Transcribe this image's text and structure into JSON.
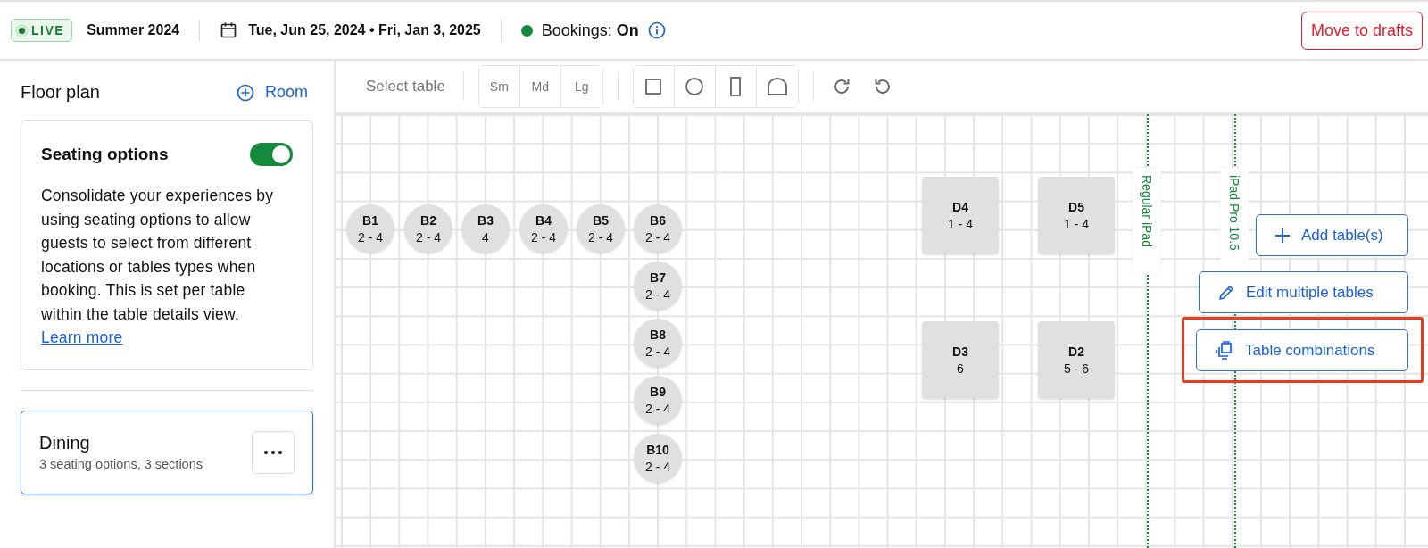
{
  "header": {
    "status_badge": "LIVE",
    "season": "Summer 2024",
    "date_range": "Tue, Jun 25, 2024 • Fri, Jan 3, 2025",
    "bookings": "Bookings: **On**",
    "bookings_on": true,
    "move_button": "Move to drafts"
  },
  "sidebar": {
    "title": "Floor plan",
    "add_room": "Room",
    "seating_options": {
      "title": "Seating options",
      "on": true,
      "description": "Consolidate your experiences by using seating options to allow guests to select from different locations or tables types when booking. This is set per table within the table details view.",
      "link": "Learn more"
    },
    "rooms": [
      {
        "name": "Dining",
        "summary": "3 seating options, 3 sections",
        "selected": true
      }
    ]
  },
  "toolbar": {
    "select_label": "Select table",
    "sizes": [
      {
        "label": "Sm",
        "selected": false
      },
      {
        "label": "Md",
        "selected": false
      },
      {
        "label": "Lg",
        "selected": false
      }
    ],
    "shapes": [
      {
        "kind": "square",
        "selected": false
      },
      {
        "kind": "circle",
        "selected": false
      },
      {
        "kind": "tall",
        "selected": false
      },
      {
        "kind": "arch",
        "selected": false
      }
    ]
  },
  "canvas": {
    "tables": [
      {
        "kind": "round",
        "name": "B1",
        "capacity": "2 - 4"
      },
      {
        "kind": "round",
        "name": "B2",
        "capacity": "2 - 4"
      },
      {
        "kind": "round",
        "name": "B3",
        "capacity": "4"
      },
      {
        "kind": "round",
        "name": "B4",
        "capacity": "2 - 4"
      },
      {
        "kind": "round",
        "name": "B5",
        "capacity": "2 - 4"
      },
      {
        "kind": "round",
        "name": "B6",
        "capacity": "2 - 4"
      },
      {
        "kind": "round",
        "name": "B7",
        "capacity": "2 - 4"
      },
      {
        "kind": "round",
        "name": "B8",
        "capacity": "2 - 4"
      },
      {
        "kind": "round",
        "name": "B9",
        "capacity": "2 - 4"
      },
      {
        "kind": "round",
        "name": "B10",
        "capacity": "2 - 4"
      },
      {
        "kind": "square",
        "name": "D4",
        "capacity": "1 - 4"
      },
      {
        "kind": "square",
        "name": "D5",
        "capacity": "1 - 4"
      },
      {
        "kind": "square",
        "name": "D3",
        "capacity": "6"
      },
      {
        "kind": "square",
        "name": "D2",
        "capacity": "5 - 6"
      }
    ],
    "guides": [
      {
        "label": "Regular iPad"
      },
      {
        "label": "iPad Pro 10.5"
      }
    ],
    "actions": [
      {
        "kind": "add",
        "label": "Add table(s)",
        "highlighted": false
      },
      {
        "kind": "edit",
        "label": "Edit multiple tables",
        "highlighted": false
      },
      {
        "kind": "combine",
        "label": "Table combinations",
        "highlighted": true
      }
    ]
  }
}
